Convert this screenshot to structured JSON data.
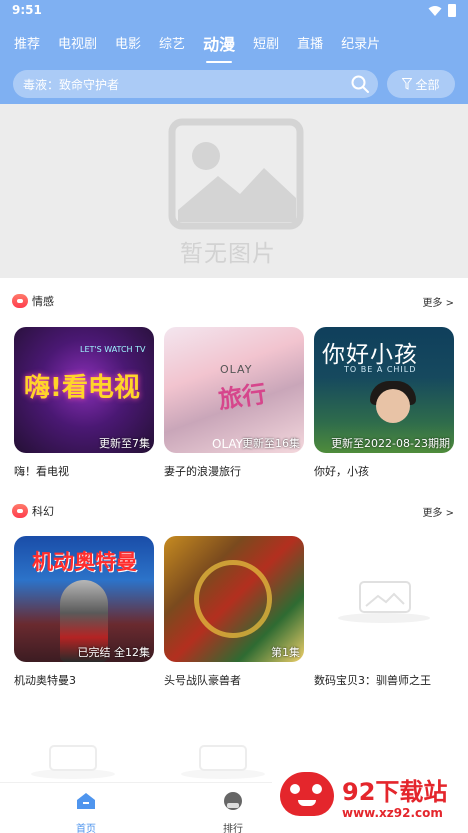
{
  "status": {
    "time": "9:51"
  },
  "tabs": [
    {
      "label": "推荐",
      "active": false
    },
    {
      "label": "电视剧",
      "active": false
    },
    {
      "label": "电影",
      "active": false
    },
    {
      "label": "综艺",
      "active": false
    },
    {
      "label": "动漫",
      "active": true
    },
    {
      "label": "短剧",
      "active": false
    },
    {
      "label": "直播",
      "active": false
    },
    {
      "label": "纪录片",
      "active": false
    }
  ],
  "search": {
    "placeholder": "毒液：致命守护者",
    "all_label": "全部"
  },
  "banner": {
    "no_image_text": "暂无图片"
  },
  "sections": [
    {
      "title": "情感",
      "more": "更多 >",
      "items": [
        {
          "name": "嗨！看电视",
          "badge": "更新至7集",
          "art": "嗨!看电视",
          "art_sub": "LET'S WATCH TV"
        },
        {
          "name": "妻子的浪漫旅行",
          "badge": "更新至16集",
          "art": "旅行",
          "art_brand": "OLAY",
          "art_brand2": "OLAY"
        },
        {
          "name": "你好，小孩",
          "badge": "更新至2022-08-23期期",
          "art": "你好小孩",
          "art_sub": "TO BE A CHILD"
        }
      ]
    },
    {
      "title": "科幻",
      "more": "更多 >",
      "items": [
        {
          "name": "机动奥特曼3",
          "badge": "已完结 全12集",
          "art": "机动奥特曼"
        },
        {
          "name": "头号战队豪兽者",
          "badge": "第1集"
        },
        {
          "name": "数码宝贝3：驯兽师之王",
          "badge": ""
        }
      ]
    }
  ],
  "tabbar": [
    {
      "label": "首页",
      "active": true
    },
    {
      "label": "排行",
      "active": false
    }
  ],
  "watermark": {
    "title": "92下载站",
    "url": "www.xz92.com"
  },
  "colors": {
    "accent": "#7fb0f2",
    "active_tab": "#4f95ee",
    "watermark_red": "#e4262c"
  }
}
